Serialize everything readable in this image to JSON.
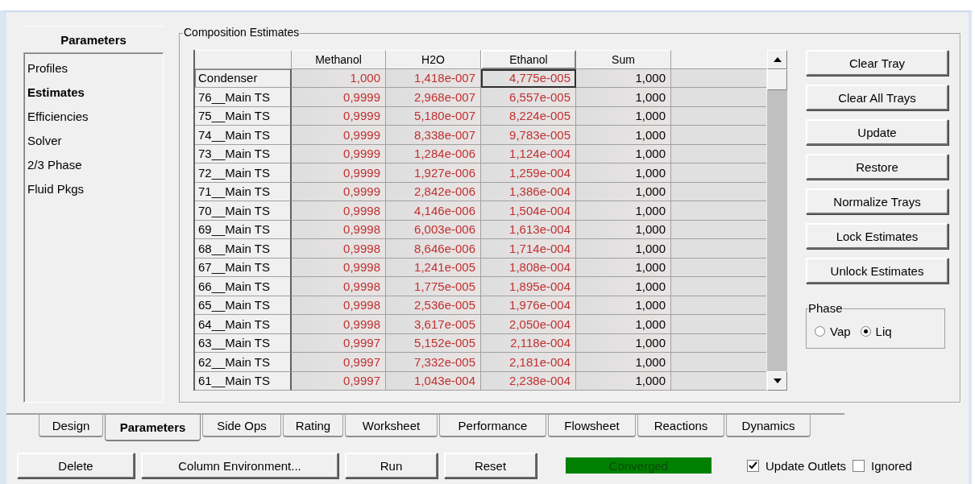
{
  "sidebar": {
    "title": "Parameters",
    "items": [
      {
        "label": "Profiles",
        "selected": false
      },
      {
        "label": "Estimates",
        "selected": true
      },
      {
        "label": "Efficiencies",
        "selected": false
      },
      {
        "label": "Solver",
        "selected": false
      },
      {
        "label": "2/3 Phase",
        "selected": false
      },
      {
        "label": "Fluid Pkgs",
        "selected": false
      }
    ]
  },
  "group": {
    "title": "Composition Estimates"
  },
  "table": {
    "columns": [
      {
        "label": "Methanol",
        "kind": "estimate",
        "selected": false
      },
      {
        "label": "H2O",
        "kind": "estimate",
        "selected": false
      },
      {
        "label": "Ethanol",
        "kind": "estimate",
        "selected": true
      },
      {
        "label": "Sum",
        "kind": "computed",
        "selected": false
      }
    ],
    "rows": [
      {
        "label": "Condenser",
        "selected": true,
        "cells": [
          "1,000",
          "1,418e-007",
          "4,775e-005",
          "1,000"
        ]
      },
      {
        "label": "76__Main TS",
        "selected": false,
        "cells": [
          "0,9999",
          "2,968e-007",
          "6,557e-005",
          "1,000"
        ]
      },
      {
        "label": "75__Main TS",
        "selected": false,
        "cells": [
          "0,9999",
          "5,180e-007",
          "8,224e-005",
          "1,000"
        ]
      },
      {
        "label": "74__Main TS",
        "selected": false,
        "cells": [
          "0,9999",
          "8,338e-007",
          "9,783e-005",
          "1,000"
        ]
      },
      {
        "label": "73__Main TS",
        "selected": false,
        "cells": [
          "0,9999",
          "1,284e-006",
          "1,124e-004",
          "1,000"
        ]
      },
      {
        "label": "72__Main TS",
        "selected": false,
        "cells": [
          "0,9999",
          "1,927e-006",
          "1,259e-004",
          "1,000"
        ]
      },
      {
        "label": "71__Main TS",
        "selected": false,
        "cells": [
          "0,9999",
          "2,842e-006",
          "1,386e-004",
          "1,000"
        ]
      },
      {
        "label": "70__Main TS",
        "selected": false,
        "cells": [
          "0,9998",
          "4,146e-006",
          "1,504e-004",
          "1,000"
        ]
      },
      {
        "label": "69__Main TS",
        "selected": false,
        "cells": [
          "0,9998",
          "6,003e-006",
          "1,613e-004",
          "1,000"
        ]
      },
      {
        "label": "68__Main TS",
        "selected": false,
        "cells": [
          "0,9998",
          "8,646e-006",
          "1,714e-004",
          "1,000"
        ]
      },
      {
        "label": "67__Main TS",
        "selected": false,
        "cells": [
          "0,9998",
          "1,241e-005",
          "1,808e-004",
          "1,000"
        ]
      },
      {
        "label": "66__Main TS",
        "selected": false,
        "cells": [
          "0,9998",
          "1,775e-005",
          "1,895e-004",
          "1,000"
        ]
      },
      {
        "label": "65__Main TS",
        "selected": false,
        "cells": [
          "0,9998",
          "2,536e-005",
          "1,976e-004",
          "1,000"
        ]
      },
      {
        "label": "64__Main TS",
        "selected": false,
        "cells": [
          "0,9998",
          "3,617e-005",
          "2,050e-004",
          "1,000"
        ]
      },
      {
        "label": "63__Main TS",
        "selected": false,
        "cells": [
          "0,9997",
          "5,152e-005",
          "2,118e-004",
          "1,000"
        ]
      },
      {
        "label": "62__Main TS",
        "selected": false,
        "cells": [
          "0,9997",
          "7,332e-005",
          "2,181e-004",
          "1,000"
        ]
      },
      {
        "label": "61__Main TS",
        "selected": false,
        "cells": [
          "0,9997",
          "1,043e-004",
          "2,238e-004",
          "1,000"
        ]
      }
    ]
  },
  "actions": [
    "Clear Tray",
    "Clear All Trays",
    "Update",
    "Restore",
    "Normalize Trays",
    "Lock Estimates",
    "Unlock Estimates"
  ],
  "phase": {
    "title": "Phase",
    "options": [
      {
        "label": "Vap",
        "selected": false
      },
      {
        "label": "Liq",
        "selected": true
      }
    ]
  },
  "tabs": [
    {
      "label": "Design",
      "selected": false
    },
    {
      "label": "Parameters",
      "selected": true
    },
    {
      "label": "Side Ops",
      "selected": false
    },
    {
      "label": "Rating",
      "selected": false
    },
    {
      "label": "Worksheet",
      "selected": false
    },
    {
      "label": "Performance",
      "selected": false
    },
    {
      "label": "Flowsheet",
      "selected": false
    },
    {
      "label": "Reactions",
      "selected": false
    },
    {
      "label": "Dynamics",
      "selected": false
    }
  ],
  "bottom_buttons": [
    "Delete",
    "Column Environment...",
    "Run",
    "Reset"
  ],
  "status": {
    "text": "Converged",
    "color": "#008000"
  },
  "options": [
    {
      "label": "Update Outlets",
      "checked": true
    },
    {
      "label": "Ignored",
      "checked": false
    }
  ]
}
